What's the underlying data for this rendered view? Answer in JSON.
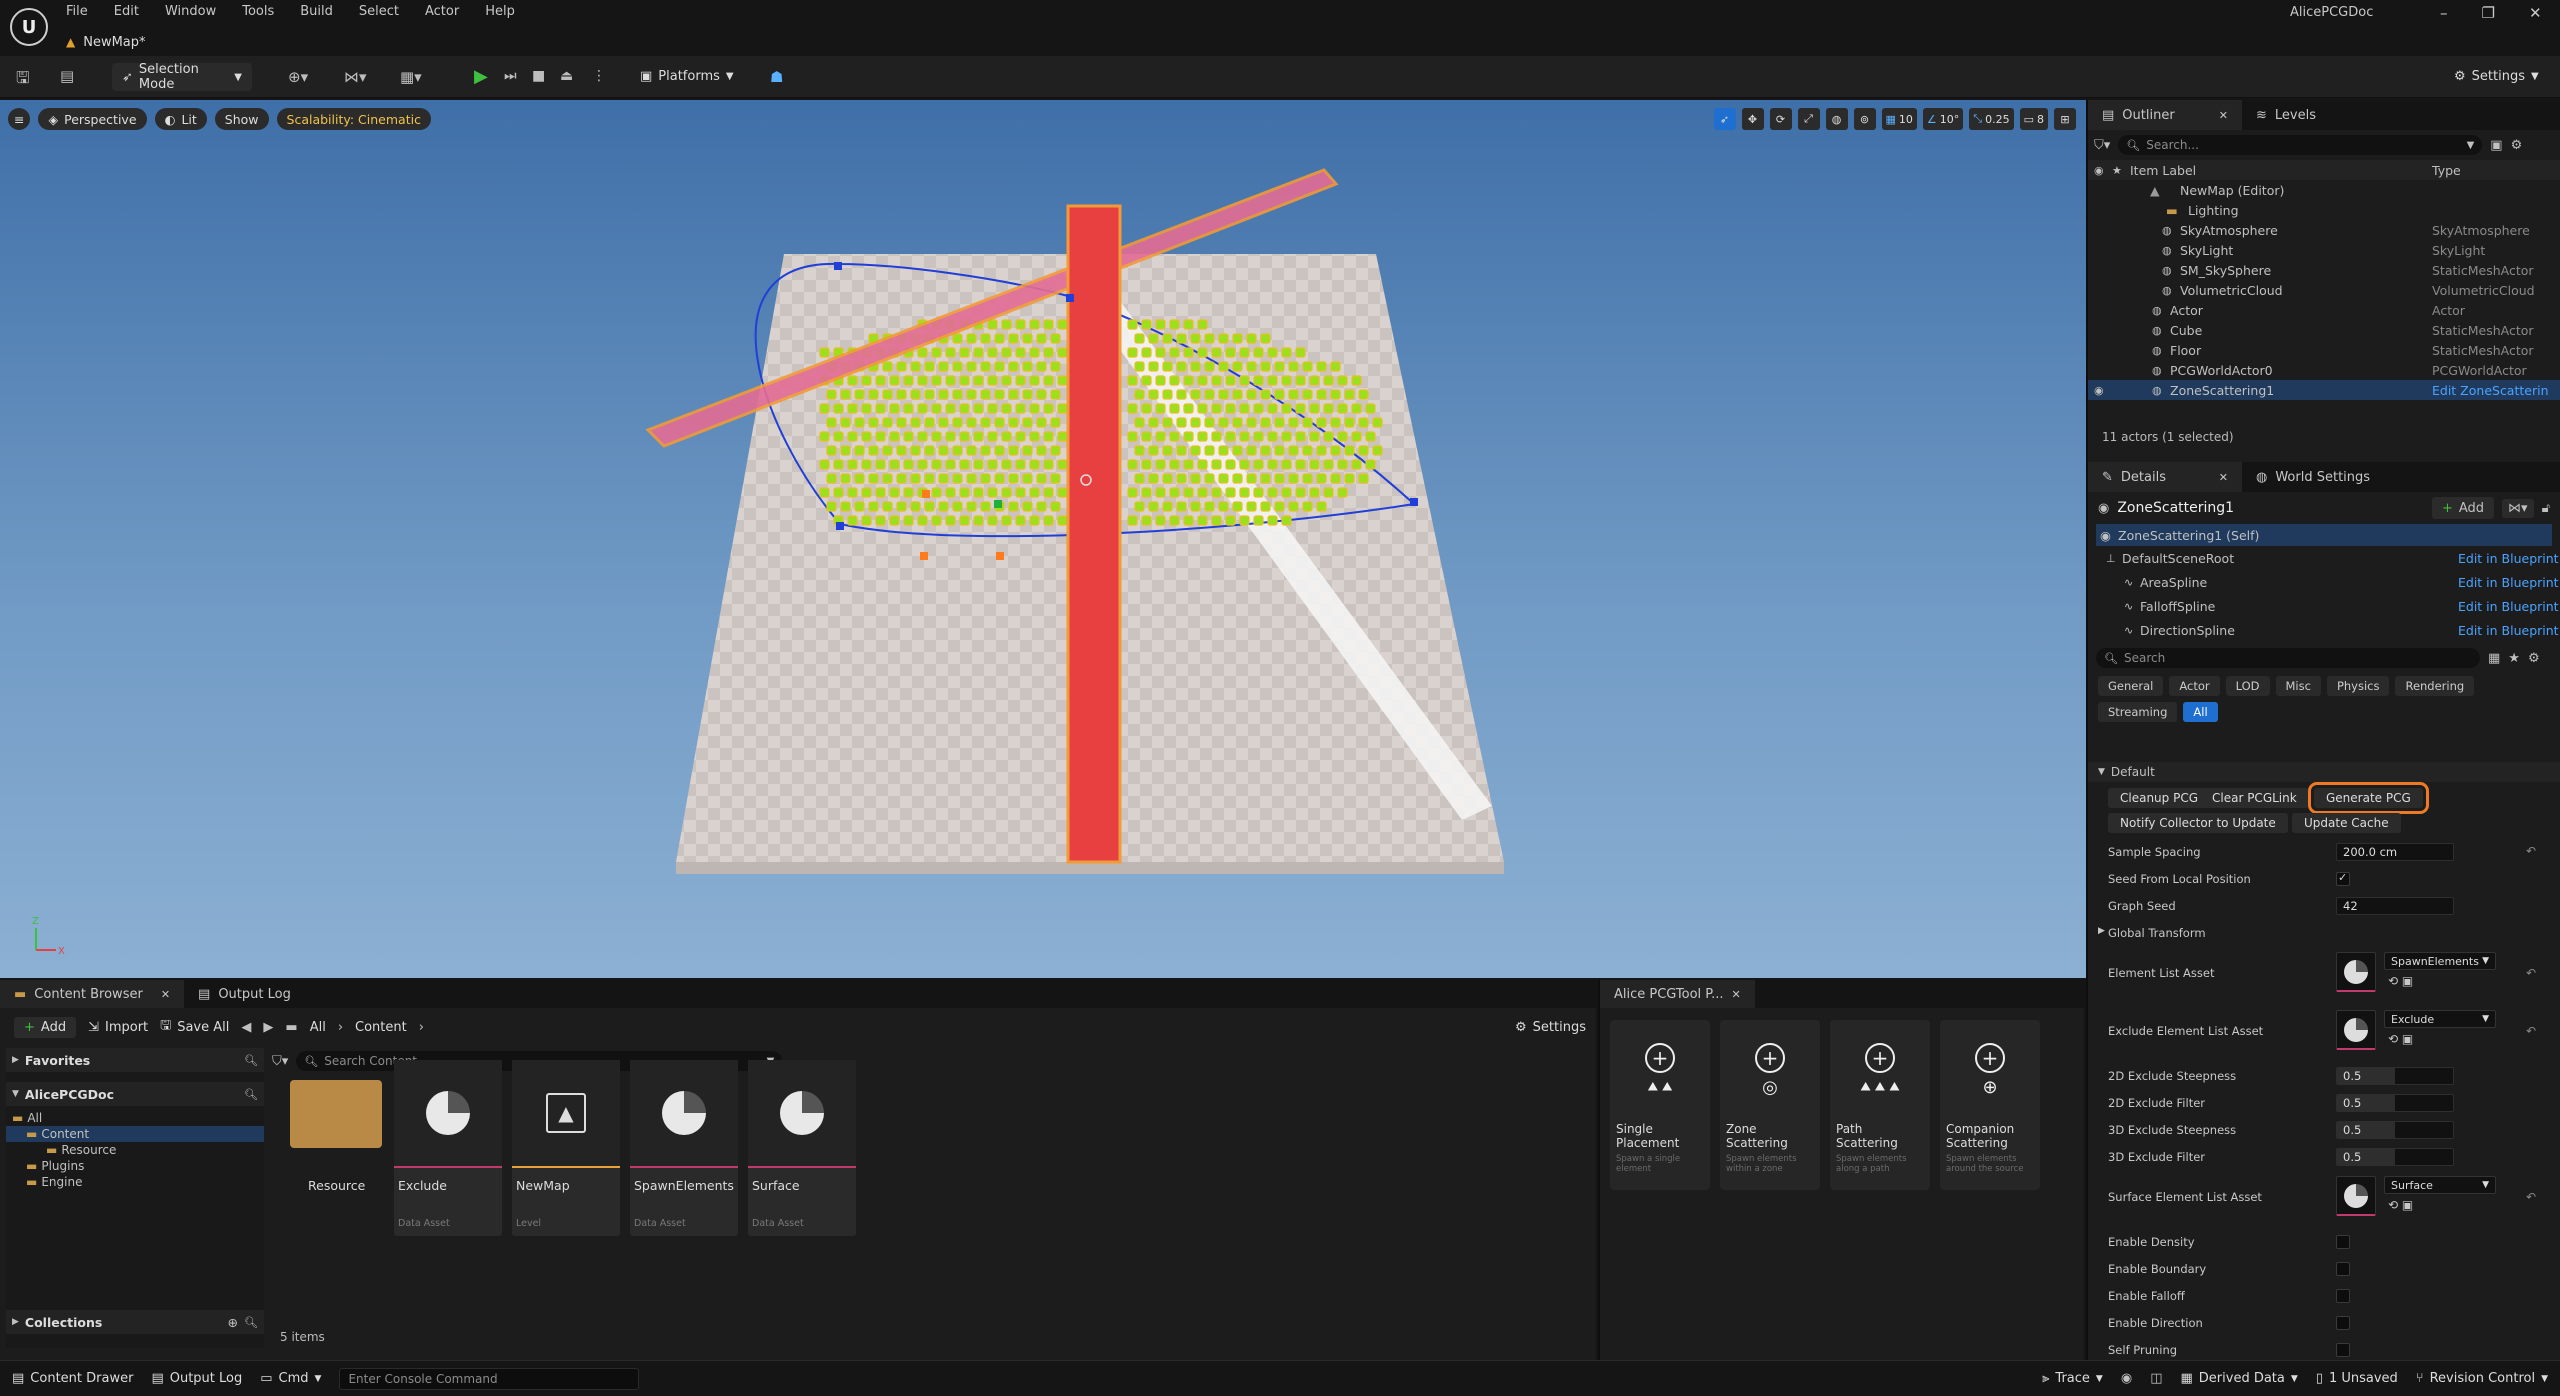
{
  "menu": [
    "File",
    "Edit",
    "Window",
    "Tools",
    "Build",
    "Select",
    "Actor",
    "Help"
  ],
  "doc_tab": "NewMap*",
  "app_title": "AlicePCGDoc",
  "toolbar": {
    "selection_mode": "Selection Mode",
    "platforms": "Platforms",
    "settings": "Settings"
  },
  "viewport": {
    "perspective": "Perspective",
    "lit": "Lit",
    "show": "Show",
    "scalability": "Scalability: Cinematic",
    "grid_snap": "10",
    "rot_snap": "10°",
    "scale_snap": "0.25",
    "camera_speed": "8"
  },
  "outliner": {
    "tab": "Outliner",
    "tab2": "Levels",
    "search_placeholder": "Search...",
    "col_label": "Item Label",
    "col_type": "Type",
    "root": "NewMap (Editor)",
    "folder": "Lighting",
    "rows": [
      {
        "label": "SkyAtmosphere",
        "type": "SkyAtmosphere"
      },
      {
        "label": "SkyLight",
        "type": "SkyLight"
      },
      {
        "label": "SM_SkySphere",
        "type": "StaticMeshActor"
      },
      {
        "label": "VolumetricCloud",
        "type": "VolumetricCloud"
      },
      {
        "label": "Actor",
        "type": "Actor"
      },
      {
        "label": "Cube",
        "type": "StaticMeshActor"
      },
      {
        "label": "Floor",
        "type": "StaticMeshActor"
      },
      {
        "label": "PCGWorldActor0",
        "type": "PCGWorldActor"
      },
      {
        "label": "ZoneScattering1",
        "type": "Edit ZoneScatterin"
      }
    ],
    "footer": "11 actors (1 selected)"
  },
  "details": {
    "tab": "Details",
    "tab2": "World Settings",
    "actor_name": "ZoneScattering1",
    "add_label": "Add",
    "self_row": "ZoneScattering1 (Self)",
    "components": [
      {
        "name": "DefaultSceneRoot",
        "link": "Edit in Blueprint"
      },
      {
        "name": "AreaSpline",
        "link": "Edit in Blueprint"
      },
      {
        "name": "FalloffSpline",
        "link": "Edit in Blueprint"
      },
      {
        "name": "DirectionSpline",
        "link": "Edit in Blueprint"
      }
    ],
    "search_placeholder": "Search",
    "categories": [
      "General",
      "Actor",
      "LOD",
      "Misc",
      "Physics",
      "Rendering",
      "Streaming",
      "All"
    ],
    "section_default": "Default",
    "buttons": {
      "cleanup": "Cleanup PCG",
      "clear": "Clear PCGLink",
      "generate": "Generate PCG",
      "notify": "Notify Collector to Update",
      "update_cache": "Update Cache"
    },
    "props": {
      "sample_spacing_label": "Sample Spacing",
      "sample_spacing_value": "200.0 cm",
      "seed_local_label": "Seed From Local Position",
      "graph_seed_label": "Graph Seed",
      "graph_seed_value": "42",
      "global_transform_label": "Global Transform",
      "element_list_label": "Element List Asset",
      "element_list_value": "SpawnElements",
      "exclude_list_label": "Exclude Element List Asset",
      "exclude_list_value": "Exclude",
      "ex2d_steep_label": "2D Exclude Steepness",
      "ex2d_steep_value": "0.5",
      "ex2d_filter_label": "2D Exclude Filter",
      "ex2d_filter_value": "0.5",
      "ex3d_steep_label": "3D Exclude Steepness",
      "ex3d_steep_value": "0.5",
      "ex3d_filter_label": "3D Exclude Filter",
      "ex3d_filter_value": "0.5",
      "surface_list_label": "Surface Element List Asset",
      "surface_list_value": "Surface",
      "enable_density": "Enable Density",
      "enable_boundary": "Enable Boundary",
      "enable_falloff": "Enable Falloff",
      "enable_direction": "Enable Direction",
      "self_pruning": "Self Pruning"
    }
  },
  "content_browser": {
    "tab": "Content Browser",
    "tab2": "Output Log",
    "add": "Add",
    "import": "Import",
    "save_all": "Save All",
    "crumb_all": "All",
    "crumb_content": "Content",
    "settings": "Settings",
    "favorites": "Favorites",
    "project": "AlicePCGDoc",
    "tree": [
      "All",
      "Content",
      "Resource",
      "Plugins",
      "Engine"
    ],
    "search_placeholder": "Search Content",
    "assets": [
      {
        "name": "Resource",
        "type": ""
      },
      {
        "name": "Exclude",
        "type": "Data Asset"
      },
      {
        "name": "NewMap",
        "type": "Level"
      },
      {
        "name": "SpawnElements",
        "type": "Data Asset"
      },
      {
        "name": "Surface",
        "type": "Data Asset"
      }
    ],
    "count": "5 items",
    "collections": "Collections"
  },
  "pcg_tool": {
    "tab": "Alice PCGTool P...",
    "tools": [
      {
        "name": "Single Placement",
        "desc": "Spawn a single element"
      },
      {
        "name": "Zone Scattering",
        "desc": "Spawn elements within a zone"
      },
      {
        "name": "Path Scattering",
        "desc": "Spawn elements along a path"
      },
      {
        "name": "Companion Scattering",
        "desc": "Spawn elements around the source"
      }
    ]
  },
  "statusbar": {
    "content_drawer": "Content Drawer",
    "output_log": "Output Log",
    "cmd": "Cmd",
    "console_placeholder": "Enter Console Command",
    "trace": "Trace",
    "derived_data": "Derived Data",
    "unsaved": "1 Unsaved",
    "revision": "Revision Control"
  }
}
